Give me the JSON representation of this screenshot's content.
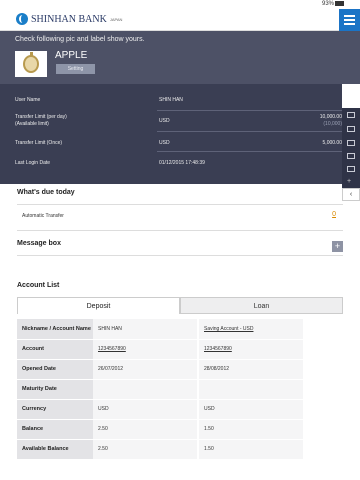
{
  "status": {
    "battery": "93%"
  },
  "header": {
    "bank_name": "SHINHAN BANK",
    "bank_sub": "JAPAN"
  },
  "profile": {
    "hint": "Check following pic and label show yours.",
    "name": "APPLE",
    "setting_label": "Setting"
  },
  "info": {
    "user_name_label": "User Name",
    "user_name": "SHIN HAN",
    "transfer_day_label1": "Transfer Limit (per day)",
    "transfer_day_label2": "(Available limit)",
    "transfer_day_currency": "USD",
    "transfer_day_value": "10,000.00",
    "transfer_day_available": "(10,000)",
    "transfer_once_label": "Transfer Limit (Once)",
    "transfer_once_currency": "USD",
    "transfer_once_value": "5,000.00",
    "last_login_label": "Last Login Date",
    "last_login_value": "01/12/2015 17:48:39"
  },
  "due": {
    "title": "What's due today",
    "automatic_transfer_label": "Automatic Transfer",
    "automatic_transfer_count": "0"
  },
  "message_box": {
    "title": "Message box",
    "plus": "+"
  },
  "account_list": {
    "title": "Account List",
    "tabs": [
      "Deposit",
      "Loan"
    ],
    "rows": [
      {
        "label": "Nickname / Account Name",
        "c1": "SHIN HAN",
        "c2": "Saving Account - USD"
      },
      {
        "label": "Account",
        "c1": "1234567890",
        "c2": "1234567890"
      },
      {
        "label": "Opened Date",
        "c1": "26/07/2012",
        "c2": "28/08/2012"
      },
      {
        "label": "Maturity Date",
        "c1": "",
        "c2": ""
      },
      {
        "label": "Currency",
        "c1": "USD",
        "c2": "USD"
      },
      {
        "label": "Balance",
        "c1": "2.50",
        "c2": "1.50"
      },
      {
        "label": "Available Balance",
        "c1": "2.50",
        "c2": "1.50"
      }
    ]
  }
}
